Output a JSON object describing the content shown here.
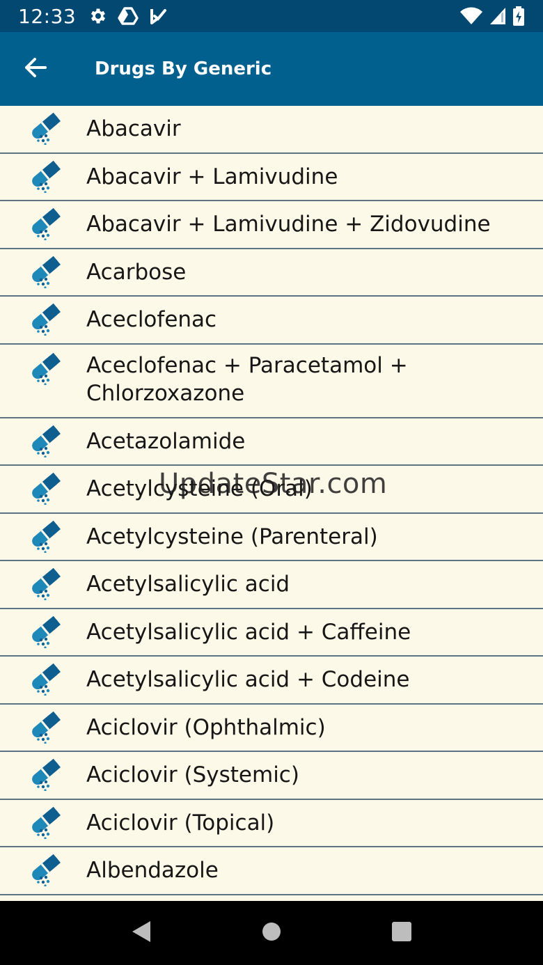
{
  "status_bar": {
    "time": "12:33",
    "left_icons": [
      "settings-icon",
      "drive-icon",
      "play-icon"
    ],
    "right_icons": [
      "wifi-icon",
      "signal-icon",
      "battery-icon"
    ]
  },
  "app_bar": {
    "back_icon": "arrow-left-icon",
    "title": "Drugs By Generic"
  },
  "drugs": [
    "Abacavir",
    "Abacavir + Lamivudine",
    "Abacavir + Lamivudine + Zidovudine",
    "Acarbose",
    "Aceclofenac",
    "Aceclofenac + Paracetamol +\nChlorzoxazone",
    "Acetazolamide",
    "Acetylcysteine (Oral)",
    "Acetylcysteine (Parenteral)",
    "Acetylsalicylic acid",
    "Acetylsalicylic acid + Caffeine",
    "Acetylsalicylic acid + Codeine",
    "Aciclovir (Ophthalmic)",
    "Aciclovir (Systemic)",
    "Aciclovir (Topical)",
    "Albendazole"
  ],
  "list_item_icon": "capsule-icon",
  "watermark": "UpdateStar.com",
  "nav_bar": {
    "icons": [
      "back-triangle-icon",
      "home-circle-icon",
      "recents-square-icon"
    ]
  },
  "colors": {
    "status_bar": "#034871",
    "app_bar": "#02608F",
    "list_background": "#FDF9E8",
    "icon_blue": "#0E5F90",
    "divider": "#5A7483"
  }
}
